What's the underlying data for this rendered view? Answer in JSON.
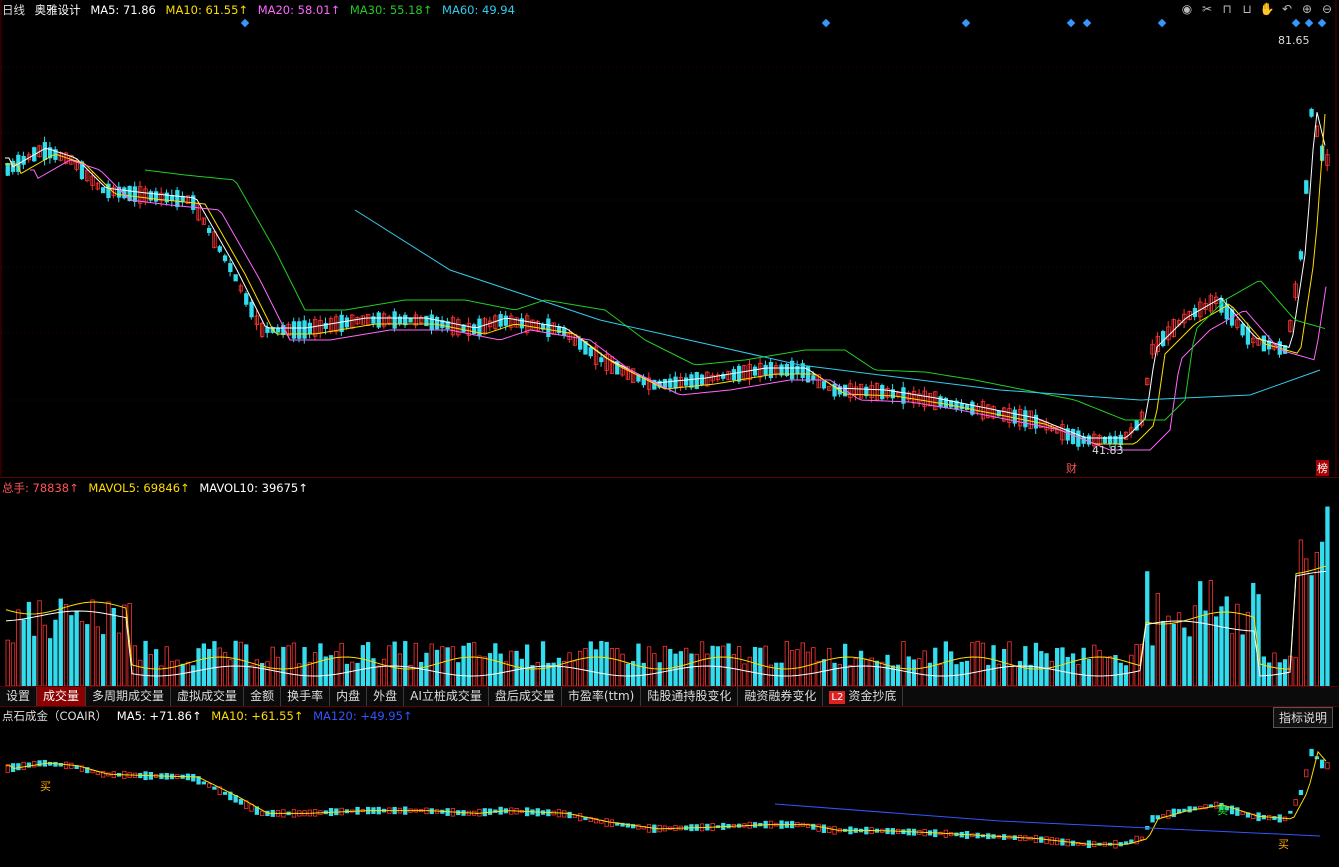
{
  "main": {
    "period": "日线",
    "stock_name": "奥雅设计",
    "ma": [
      {
        "label": "MA5: 71.86",
        "color": "#ffffff"
      },
      {
        "label": "MA10: 61.55↑",
        "color": "#ffdd00"
      },
      {
        "label": "MA20: 58.01↑",
        "color": "#ff66ff"
      },
      {
        "label": "MA30: 55.18↑",
        "color": "#22cc22"
      },
      {
        "label": "MA60: 49.94",
        "color": "#33ccee"
      }
    ],
    "high_label": "81.65",
    "low_label": "41.83",
    "bang_label": "榜",
    "cai_label": "财"
  },
  "volume": {
    "labels": [
      {
        "label": "总手: 78838↑",
        "color": "#ff5555"
      },
      {
        "label": "MAVOL5: 69846↑",
        "color": "#ffdd00"
      },
      {
        "label": "MAVOL10: 39675↑",
        "color": "#ffffff"
      }
    ]
  },
  "tabs": [
    "设置",
    "成交量",
    "多周期成交量",
    "虚拟成交量",
    "金额",
    "换手率",
    "内盘",
    "外盘",
    "AI立桩成交量",
    "盘后成交量",
    "市盈率(ttm)",
    "陆股通持股变化",
    "融资融券变化",
    "资金抄底"
  ],
  "tabs_active_index": 1,
  "tab_l2_badge": "L2",
  "indicator": {
    "title": "点石成金（COAIR）",
    "labels": [
      {
        "label": "MA5: +71.86↑",
        "color": "#ffffff"
      },
      {
        "label": "MA10: +61.55↑",
        "color": "#ffdd00"
      },
      {
        "label": "MA120: +49.95↑",
        "color": "#3355ff"
      }
    ],
    "help_button": "指标说明",
    "buy_label": "买",
    "sell_label": "卖"
  },
  "toolbar_icons": [
    "eye-icon",
    "scissors-icon",
    "lock-icon",
    "unlock-icon",
    "hand-icon",
    "undo-icon",
    "zoom-in-icon",
    "zoom-out-icon"
  ],
  "colors": {
    "up": "#ff3333",
    "down": "#33ddee",
    "background": "#000000"
  }
}
